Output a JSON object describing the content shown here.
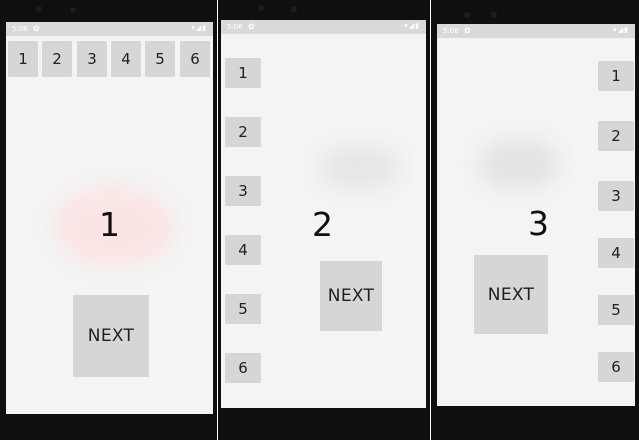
{
  "time": "5:06",
  "status_icons": "▾◢▮",
  "screens": [
    {
      "buttons": [
        "1",
        "2",
        "3",
        "4",
        "5",
        "6"
      ],
      "page_number": "1",
      "next_label": "NEXT"
    },
    {
      "buttons": [
        "1",
        "2",
        "3",
        "4",
        "5",
        "6"
      ],
      "page_number": "2",
      "next_label": "NEXT"
    },
    {
      "buttons": [
        "1",
        "2",
        "3",
        "4",
        "5",
        "6"
      ],
      "page_number": "3",
      "next_label": "NEXT"
    }
  ],
  "icons": {
    "gear": "settings-icon",
    "back": "back-icon",
    "home": "home-icon",
    "recents": "recents-icon"
  }
}
